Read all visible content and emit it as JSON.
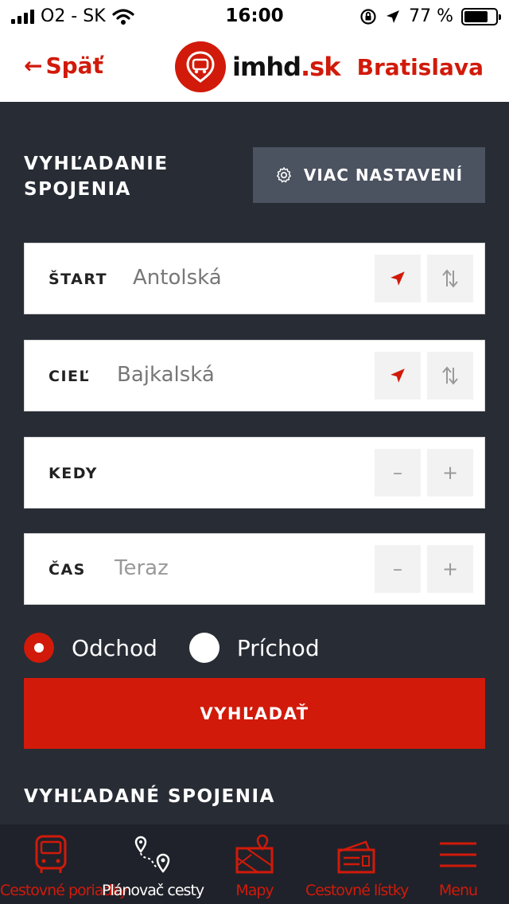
{
  "status": {
    "carrier": "O2 - SK",
    "time": "16:00",
    "battery": "77 %"
  },
  "nav": {
    "back": "Späť",
    "logo_main": "imhd",
    "logo_dot": ".sk",
    "city": "Bratislava"
  },
  "search": {
    "title_line1": "VYHĽADANIE",
    "title_line2": "SPOJENIA",
    "settings_label": "VIAC NASTAVENÍ"
  },
  "fields": {
    "start": {
      "label": "ŠTART",
      "value": "Antolská"
    },
    "dest": {
      "label": "CIEĽ",
      "value": "Bajkalská"
    },
    "when": {
      "label": "KEDY",
      "value": ""
    },
    "time": {
      "label": "ČAS",
      "value": "Teraz"
    },
    "minus": "–",
    "plus": "+"
  },
  "mode": {
    "departure": "Odchod",
    "arrival": "Príchod",
    "selected": "departure"
  },
  "search_button": "VYHĽADAŤ",
  "results_title": "VYHĽADANÉ SPOJENIA",
  "tabs": [
    {
      "label": "Cestovné poriadky",
      "icon": "bus-icon"
    },
    {
      "label": "Plánovač cesty",
      "icon": "route-icon"
    },
    {
      "label": "Mapy",
      "icon": "map-icon"
    },
    {
      "label": "Cestovné lístky",
      "icon": "ticket-icon"
    },
    {
      "label": "Menu",
      "icon": "menu-icon"
    }
  ],
  "colors": {
    "accent": "#d11a0a",
    "background": "#282c35",
    "tabbar": "#1f222a"
  }
}
